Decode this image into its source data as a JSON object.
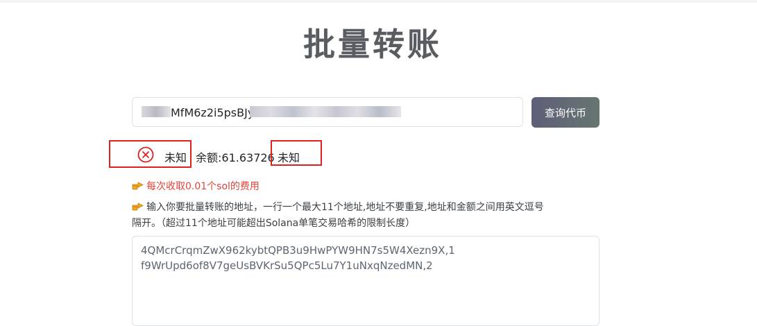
{
  "page": {
    "title": "批量转账"
  },
  "search": {
    "address_visible_fragment": "MfM6z2i5psBJyv",
    "button_label": "查询代币"
  },
  "status": {
    "icon": "x-circle-icon",
    "left_label": "未知",
    "balance_label": "余额:61.63726",
    "right_label": "未知",
    "error_color": "#e02020"
  },
  "notes": {
    "fee_text": "每次收取0.01个sol的费用",
    "instruction_line1": "输入你要批量转账的地址，一行一个最大11个地址,地址不要重复,地址和金额之间用英文逗号",
    "instruction_line2": "隔开。（超过11个地址可能超出Solana单笔交易哈希的限制长度）",
    "pointer_icon": "pointing-hand-icon"
  },
  "transfers": {
    "lines": [
      "4QMcrCrqmZwX962kybtQPB3u9HwPYW9HN7s5W4Xezn9X,1",
      "f9WrUpd6of8V7geUsBVKrSu5QPc5Lu7Y1uNxqNzedMN,2"
    ]
  }
}
